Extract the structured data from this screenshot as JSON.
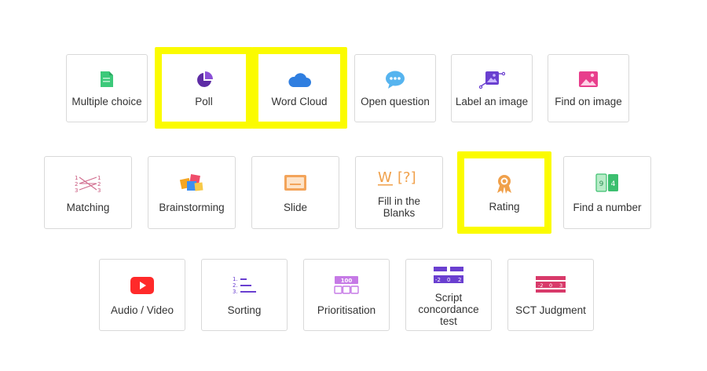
{
  "tiles": [
    {
      "id": "multiple-choice",
      "label": "Multiple choice",
      "icon": "document-icon",
      "highlighted": false
    },
    {
      "id": "poll",
      "label": "Poll",
      "icon": "pie-chart-icon",
      "highlighted": true
    },
    {
      "id": "word-cloud",
      "label": "Word Cloud",
      "icon": "cloud-icon",
      "highlighted": true
    },
    {
      "id": "open-question",
      "label": "Open question",
      "icon": "speech-bubble-icon",
      "highlighted": false
    },
    {
      "id": "label-an-image",
      "label": "Label an image",
      "icon": "image-label-icon",
      "highlighted": false
    },
    {
      "id": "find-on-image",
      "label": "Find on image",
      "icon": "image-icon",
      "highlighted": false
    },
    {
      "id": "matching",
      "label": "Matching",
      "icon": "matching-icon",
      "highlighted": false
    },
    {
      "id": "brainstorming",
      "label": "Brainstorming",
      "icon": "sticky-notes-icon",
      "highlighted": false
    },
    {
      "id": "slide",
      "label": "Slide",
      "icon": "slide-icon",
      "highlighted": false
    },
    {
      "id": "fill-in-the-blanks",
      "label": "Fill in the\nBlanks",
      "icon": "fill-blanks-icon",
      "highlighted": false,
      "icon_text": [
        "W",
        "[?]"
      ]
    },
    {
      "id": "rating",
      "label": "Rating",
      "icon": "award-ribbon-icon",
      "highlighted": true
    },
    {
      "id": "find-a-number",
      "label": "Find a number",
      "icon": "number-cards-icon",
      "highlighted": false,
      "icon_text": [
        "9",
        "4"
      ]
    },
    {
      "id": "audio-video",
      "label": "Audio / Video",
      "icon": "play-button-icon",
      "highlighted": false
    },
    {
      "id": "sorting",
      "label": "Sorting",
      "icon": "ordered-list-icon",
      "highlighted": false,
      "icon_text": [
        "1.",
        "2.",
        "3."
      ]
    },
    {
      "id": "prioritisation",
      "label": "Prioritisation",
      "icon": "points-allocation-icon",
      "highlighted": false,
      "icon_text": [
        "100"
      ]
    },
    {
      "id": "script-concordance-test",
      "label": "Script\nconcordance\ntest",
      "icon": "likert-scale-icon",
      "highlighted": false,
      "icon_text": [
        "-2",
        "0",
        "2"
      ]
    },
    {
      "id": "sct-judgment",
      "label": "SCT Judgment",
      "icon": "judgment-scale-icon",
      "highlighted": false,
      "icon_text": [
        "-2",
        "0",
        "3"
      ]
    }
  ],
  "colors": {
    "highlight": "#fbfb00",
    "border": "#d9d9d9",
    "text": "#333333"
  }
}
